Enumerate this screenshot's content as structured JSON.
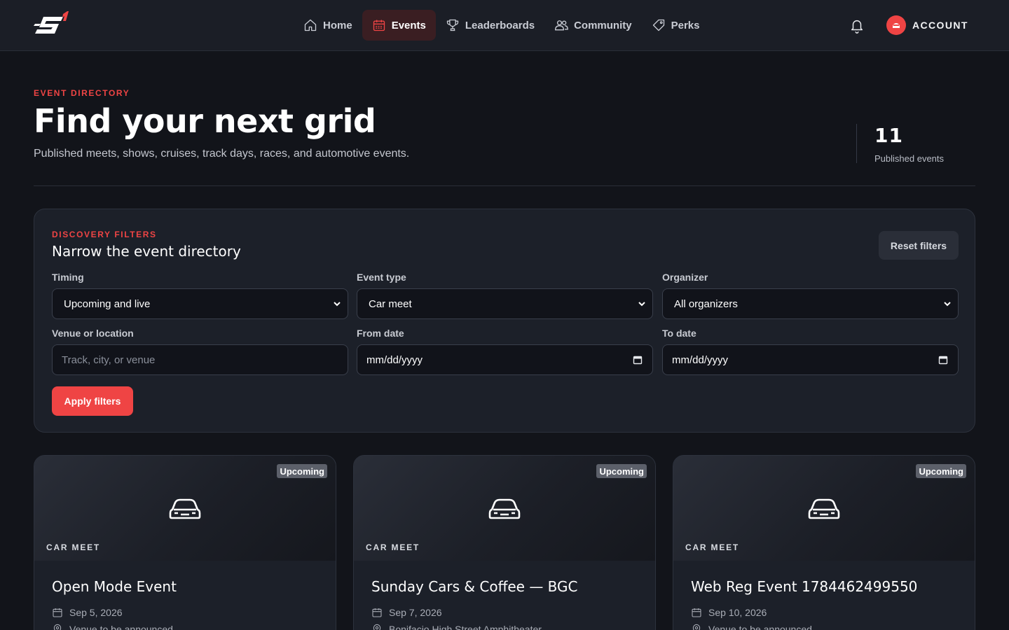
{
  "nav": {
    "items": [
      {
        "label": "Home",
        "icon": "home-icon",
        "active": false
      },
      {
        "label": "Events",
        "icon": "calendar-icon",
        "active": true
      },
      {
        "label": "Leaderboards",
        "icon": "trophy-icon",
        "active": false
      },
      {
        "label": "Community",
        "icon": "users-icon",
        "active": false
      },
      {
        "label": "Perks",
        "icon": "tag-icon",
        "active": false
      }
    ],
    "account_label": "ACCOUNT"
  },
  "header": {
    "eyebrow": "EVENT DIRECTORY",
    "title": "Find your next grid",
    "subtitle": "Published meets, shows, cruises, track days, races, and automotive events.",
    "stat_value": "11",
    "stat_label": "Published events"
  },
  "filters": {
    "kicker": "DISCOVERY FILTERS",
    "heading": "Narrow the event directory",
    "reset_label": "Reset filters",
    "apply_label": "Apply filters",
    "timing": {
      "label": "Timing",
      "value": "Upcoming and live"
    },
    "event_type": {
      "label": "Event type",
      "value": "Car meet"
    },
    "organizer": {
      "label": "Organizer",
      "value": "All organizers"
    },
    "venue": {
      "label": "Venue or location",
      "placeholder": "Track, city, or venue"
    },
    "from_date": {
      "label": "From date",
      "value": "mm/dd/yyyy"
    },
    "to_date": {
      "label": "To date",
      "value": "mm/dd/yyyy"
    }
  },
  "events": [
    {
      "badge": "Upcoming",
      "type": "CAR MEET",
      "title": "Open Mode Event",
      "date": "Sep 5, 2026",
      "venue": "Venue to be announced"
    },
    {
      "badge": "Upcoming",
      "type": "CAR MEET",
      "title": "Sunday Cars & Coffee — BGC",
      "date": "Sep 7, 2026",
      "venue": "Bonifacio High Street Amphitheater"
    },
    {
      "badge": "Upcoming",
      "type": "CAR MEET",
      "title": "Web Reg Event 1784462499550",
      "date": "Sep 10, 2026",
      "venue": "Venue to be announced"
    }
  ],
  "colors": {
    "accent": "#ef4444",
    "background": "#12141a",
    "panel": "#1c2029",
    "nav": "#1b1e26"
  }
}
